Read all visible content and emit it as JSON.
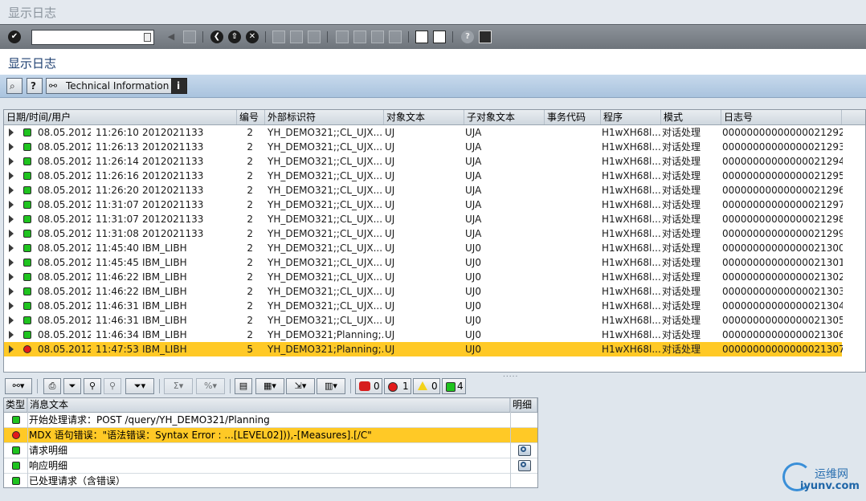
{
  "window": {
    "title": "显示日志"
  },
  "std_toolbar": {
    "command_field_value": ""
  },
  "screen": {
    "title": "显示日志"
  },
  "app_toolbar": {
    "technical_info_label": "Technical Information"
  },
  "log_table": {
    "headers": [
      "日期/时间/用户",
      "编号",
      "外部标识符",
      "对象文本",
      "子对象文本",
      "事务代码",
      "程序",
      "模式",
      "日志号"
    ],
    "rows": [
      {
        "date": "08.05.2012",
        "time": "11:26:10",
        "user": "2012021133",
        "num": "2",
        "ext_id": "YH_DEMO321;;CL_UJX...",
        "obj": "UJ",
        "subobj": "UJA",
        "tcode": "",
        "program": "H1wXH68l...",
        "mode": "对话处理",
        "log_no": "00000000000000021292",
        "status": "green"
      },
      {
        "date": "08.05.2012",
        "time": "11:26:13",
        "user": "2012021133",
        "num": "2",
        "ext_id": "YH_DEMO321;;CL_UJX...",
        "obj": "UJ",
        "subobj": "UJA",
        "tcode": "",
        "program": "H1wXH68l...",
        "mode": "对话处理",
        "log_no": "00000000000000021293",
        "status": "green"
      },
      {
        "date": "08.05.2012",
        "time": "11:26:14",
        "user": "2012021133",
        "num": "2",
        "ext_id": "YH_DEMO321;;CL_UJX...",
        "obj": "UJ",
        "subobj": "UJA",
        "tcode": "",
        "program": "H1wXH68l...",
        "mode": "对话处理",
        "log_no": "00000000000000021294",
        "status": "green"
      },
      {
        "date": "08.05.2012",
        "time": "11:26:16",
        "user": "2012021133",
        "num": "2",
        "ext_id": "YH_DEMO321;;CL_UJX...",
        "obj": "UJ",
        "subobj": "UJA",
        "tcode": "",
        "program": "H1wXH68l...",
        "mode": "对话处理",
        "log_no": "00000000000000021295",
        "status": "green"
      },
      {
        "date": "08.05.2012",
        "time": "11:26:20",
        "user": "2012021133",
        "num": "2",
        "ext_id": "YH_DEMO321;;CL_UJX...",
        "obj": "UJ",
        "subobj": "UJA",
        "tcode": "",
        "program": "H1wXH68l...",
        "mode": "对话处理",
        "log_no": "00000000000000021296",
        "status": "green"
      },
      {
        "date": "08.05.2012",
        "time": "11:31:07",
        "user": "2012021133",
        "num": "2",
        "ext_id": "YH_DEMO321;;CL_UJX...",
        "obj": "UJ",
        "subobj": "UJA",
        "tcode": "",
        "program": "H1wXH68l...",
        "mode": "对话处理",
        "log_no": "00000000000000021297",
        "status": "green"
      },
      {
        "date": "08.05.2012",
        "time": "11:31:07",
        "user": "2012021133",
        "num": "2",
        "ext_id": "YH_DEMO321;;CL_UJX...",
        "obj": "UJ",
        "subobj": "UJA",
        "tcode": "",
        "program": "H1wXH68l...",
        "mode": "对话处理",
        "log_no": "00000000000000021298",
        "status": "green"
      },
      {
        "date": "08.05.2012",
        "time": "11:31:08",
        "user": "2012021133",
        "num": "2",
        "ext_id": "YH_DEMO321;;CL_UJX...",
        "obj": "UJ",
        "subobj": "UJA",
        "tcode": "",
        "program": "H1wXH68l...",
        "mode": "对话处理",
        "log_no": "00000000000000021299",
        "status": "green"
      },
      {
        "date": "08.05.2012",
        "time": "11:45:40",
        "user": "IBM_LIBH",
        "num": "2",
        "ext_id": "YH_DEMO321;;CL_UJX...",
        "obj": "UJ",
        "subobj": "UJ0",
        "tcode": "",
        "program": "H1wXH68l...",
        "mode": "对话处理",
        "log_no": "00000000000000021300",
        "status": "green"
      },
      {
        "date": "08.05.2012",
        "time": "11:45:45",
        "user": "IBM_LIBH",
        "num": "2",
        "ext_id": "YH_DEMO321;;CL_UJX...",
        "obj": "UJ",
        "subobj": "UJ0",
        "tcode": "",
        "program": "H1wXH68l...",
        "mode": "对话处理",
        "log_no": "00000000000000021301",
        "status": "green"
      },
      {
        "date": "08.05.2012",
        "time": "11:46:22",
        "user": "IBM_LIBH",
        "num": "2",
        "ext_id": "YH_DEMO321;;CL_UJX...",
        "obj": "UJ",
        "subobj": "UJ0",
        "tcode": "",
        "program": "H1wXH68l...",
        "mode": "对话处理",
        "log_no": "00000000000000021302",
        "status": "green"
      },
      {
        "date": "08.05.2012",
        "time": "11:46:22",
        "user": "IBM_LIBH",
        "num": "2",
        "ext_id": "YH_DEMO321;;CL_UJX...",
        "obj": "UJ",
        "subobj": "UJ0",
        "tcode": "",
        "program": "H1wXH68l...",
        "mode": "对话处理",
        "log_no": "00000000000000021303",
        "status": "green"
      },
      {
        "date": "08.05.2012",
        "time": "11:46:31",
        "user": "IBM_LIBH",
        "num": "2",
        "ext_id": "YH_DEMO321;;CL_UJX...",
        "obj": "UJ",
        "subobj": "UJ0",
        "tcode": "",
        "program": "H1wXH68l...",
        "mode": "对话处理",
        "log_no": "00000000000000021304",
        "status": "green"
      },
      {
        "date": "08.05.2012",
        "time": "11:46:31",
        "user": "IBM_LIBH",
        "num": "2",
        "ext_id": "YH_DEMO321;;CL_UJX...",
        "obj": "UJ",
        "subobj": "UJ0",
        "tcode": "",
        "program": "H1wXH68l...",
        "mode": "对话处理",
        "log_no": "00000000000000021305",
        "status": "green"
      },
      {
        "date": "08.05.2012",
        "time": "11:46:34",
        "user": "IBM_LIBH",
        "num": "2",
        "ext_id": "YH_DEMO321;Planning;...",
        "obj": "UJ",
        "subobj": "UJ0",
        "tcode": "",
        "program": "H1wXH68l...",
        "mode": "对话处理",
        "log_no": "00000000000000021306",
        "status": "green"
      },
      {
        "date": "08.05.2012",
        "time": "11:47:53",
        "user": "IBM_LIBH",
        "num": "5",
        "ext_id": "YH_DEMO321;Planning;...",
        "obj": "UJ",
        "subobj": "UJ0",
        "tcode": "",
        "program": "H1wXH68l...",
        "mode": "对话处理",
        "log_no": "00000000000000021307",
        "status": "red",
        "selected": true
      }
    ]
  },
  "msg_toolbar": {
    "stop_count": "0",
    "error_count": "1",
    "warning_count": "0",
    "success_count": "4"
  },
  "msg_table": {
    "headers": [
      "类型",
      "消息文本",
      "明细"
    ],
    "rows": [
      {
        "status": "green",
        "text": "开始处理请求：POST /query/YH_DEMO321/Planning",
        "detail": false
      },
      {
        "status": "red",
        "text": "MDX 语句错误：\"语法错误：Syntax Error : ...[LEVEL02])),-[Measures].[/C\"",
        "detail": false,
        "selected": true
      },
      {
        "status": "green",
        "text": "请求明细",
        "detail": true
      },
      {
        "status": "green",
        "text": "响应明细",
        "detail": true
      },
      {
        "status": "green",
        "text": "已处理请求（含错误）",
        "detail": false
      }
    ]
  },
  "watermark": {
    "name": "运维网",
    "url": "iyunv.com"
  },
  "colors": {
    "selected_row": "#ffc926",
    "status_green": "#1fc31f",
    "status_red": "#e21a1a",
    "app_toolbar": "#b8cfe6"
  }
}
